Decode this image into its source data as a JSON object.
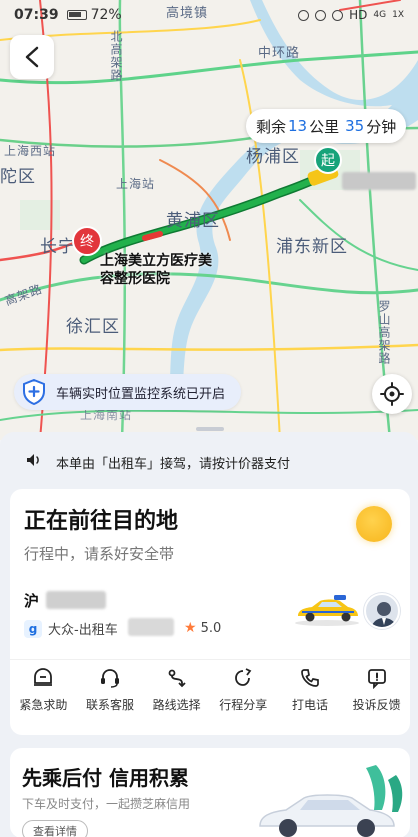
{
  "status_bar": {
    "time": "07:39",
    "battery": "72%",
    "network": "HD",
    "network_gen": "4G",
    "signal_extra": "1X"
  },
  "map": {
    "labels": {
      "gaoqiao": "高境镇",
      "zhonghuan": "中环路",
      "shanghai_west": "上海西站",
      "putuo": "陀区",
      "yangpu": "杨浦区",
      "shanghai_station": "上海站",
      "huangpu": "黄浦区",
      "pudong": "浦东新区",
      "changning": "长宁",
      "xuhui": "徐汇区",
      "north_elevated": "北高架路",
      "gaojia": "高架路",
      "luoshan": "罗山高架路",
      "shanghai_south": "上海南站"
    },
    "eta": {
      "prefix": "剩余",
      "km": "13",
      "km_unit": "公里",
      "min": "35",
      "min_unit": "分钟"
    },
    "start_marker": "起",
    "end_marker": "终",
    "destination": "上海美立方医疗美容整形医院",
    "route_color": "#1aa34a",
    "monitor_text": "车辆实时位置监控系统已开启"
  },
  "notice": {
    "text": "本单由「出租车」接驾，请按计价器支付"
  },
  "trip": {
    "status_title": "正在前往目的地",
    "status_sub": "行程中，请系好安全带",
    "plate_prefix": "沪",
    "company": "大众-出租车",
    "rating": "5.0",
    "actions": [
      {
        "label": "紧急求助",
        "icon": "emergency-icon"
      },
      {
        "label": "联系客服",
        "icon": "headset-icon"
      },
      {
        "label": "路线选择",
        "icon": "route-icon"
      },
      {
        "label": "行程分享",
        "icon": "share-icon"
      },
      {
        "label": "打电话",
        "icon": "phone-icon"
      },
      {
        "label": "投诉反馈",
        "icon": "feedback-icon"
      }
    ]
  },
  "promo": {
    "title": "先乘后付 信用积累",
    "subtitle": "下车及时支付，一起攒芝麻信用",
    "button": "查看详情"
  }
}
